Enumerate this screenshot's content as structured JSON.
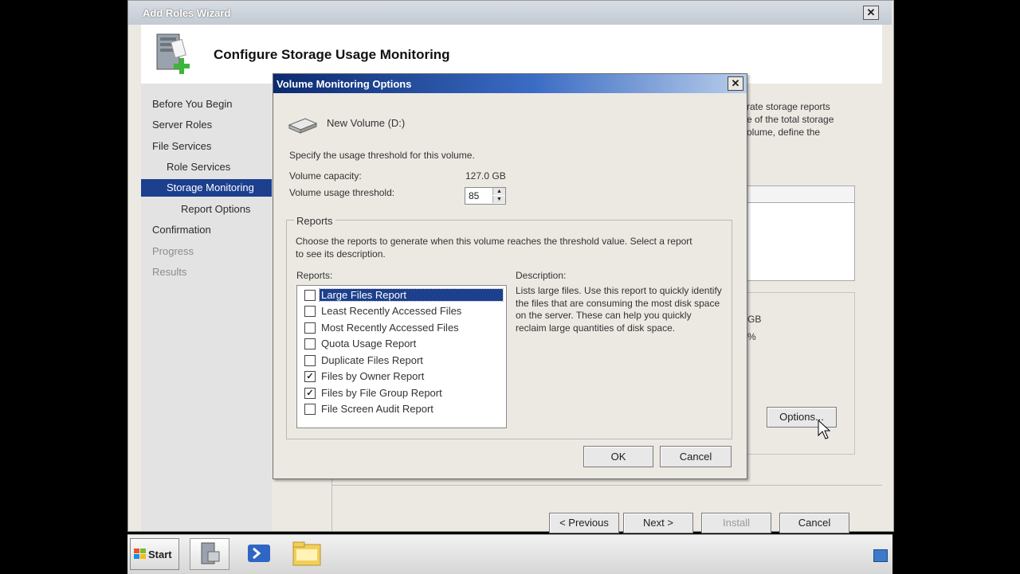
{
  "wizard": {
    "title": "Add Roles Wizard",
    "header_title": "Configure Storage Usage Monitoring",
    "nav": [
      {
        "label": "Before You Begin",
        "state": "normal"
      },
      {
        "label": "Server Roles",
        "state": "normal"
      },
      {
        "label": "File Services",
        "state": "normal"
      },
      {
        "label": "Role Services",
        "state": "normal"
      },
      {
        "label": "Storage Monitoring",
        "state": "active"
      },
      {
        "label": "Report Options",
        "state": "normal"
      },
      {
        "label": "Confirmation",
        "state": "normal"
      },
      {
        "label": "Progress",
        "state": "disabled"
      },
      {
        "label": "Results",
        "state": "disabled"
      }
    ],
    "bg_text": [
      "rate storage reports",
      "e of the total storage",
      "olume, define the",
      "GB",
      "%"
    ],
    "options_button": "Options...",
    "buttons": {
      "previous": "< Previous",
      "next": "Next >",
      "install": "Install",
      "cancel": "Cancel"
    }
  },
  "dialog": {
    "title": "Volume Monitoring Options",
    "volume_name": "New Volume (D:)",
    "instruction": "Specify the usage threshold for this volume.",
    "capacity_label": "Volume capacity:",
    "capacity_value": "127.0 GB",
    "threshold_label": "Volume usage threshold:",
    "threshold_value": "85",
    "reports_group_title": "Reports",
    "reports_instruction_1": "Choose the reports to generate when this volume reaches the threshold value. Select a report",
    "reports_instruction_2": "to see its description.",
    "reports_label": "Reports:",
    "description_label": "Description:",
    "reports": [
      {
        "label": "Large Files Report",
        "checked": false,
        "selected": true
      },
      {
        "label": "Least Recently Accessed Files",
        "checked": false,
        "selected": false
      },
      {
        "label": "Most Recently Accessed Files",
        "checked": false,
        "selected": false
      },
      {
        "label": "Quota Usage Report",
        "checked": false,
        "selected": false
      },
      {
        "label": "Duplicate Files Report",
        "checked": false,
        "selected": false
      },
      {
        "label": "Files by Owner Report",
        "checked": true,
        "selected": false
      },
      {
        "label": "Files by File Group Report",
        "checked": true,
        "selected": false
      },
      {
        "label": "File Screen Audit Report",
        "checked": false,
        "selected": false
      }
    ],
    "description": "Lists large files. Use this report to quickly identify the files that are consuming the most disk space on the server. These can help you quickly reclaim large quantities of disk space.",
    "ok": "OK",
    "cancel": "Cancel"
  },
  "taskbar": {
    "start_label": "Start",
    "items": [
      "server-manager-icon",
      "powershell-icon",
      "explorer-folder-icon"
    ]
  }
}
